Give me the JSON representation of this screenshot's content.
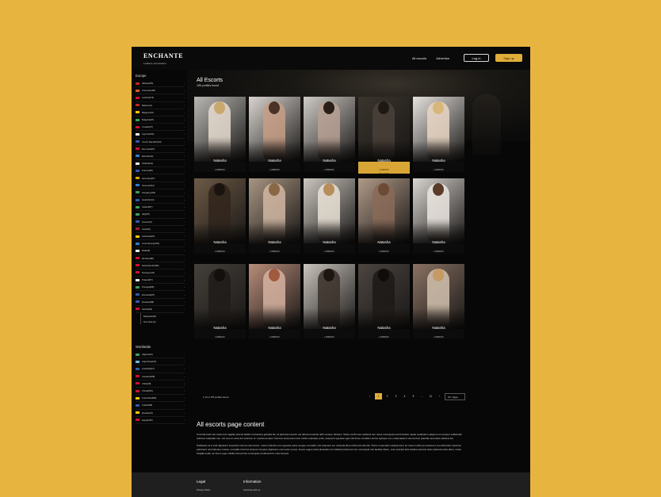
{
  "brand": {
    "name": "ENCHANTE",
    "tagline": "endless sensations"
  },
  "nav": {
    "links": [
      "All escorts",
      "Advertise"
    ],
    "login": "Log in",
    "signup": "Sign up"
  },
  "sidebar": {
    "europe_heading": "Europe",
    "europe": [
      {
        "label": "Albania(65)",
        "color": "#c0231e"
      },
      {
        "label": "Armenia(196)",
        "color": "#d35b28"
      },
      {
        "label": "Austria(374)",
        "color": "#c8102e"
      },
      {
        "label": "Belarus(4)",
        "color": "#b8262b"
      },
      {
        "label": "Belgium(87)",
        "color": "#f2c500"
      },
      {
        "label": "Bulgaria(87)",
        "color": "#3c9c58"
      },
      {
        "label": "Croatia(47)",
        "color": "#c8102e"
      },
      {
        "label": "Cyprus(194)",
        "color": "#e8e8e8"
      },
      {
        "label": "Czech Republic(34)",
        "color": "#2f58a8"
      },
      {
        "label": "Denmark(87)",
        "color": "#c8102e"
      },
      {
        "label": "Estonia(44)",
        "color": "#2f79c8"
      },
      {
        "label": "Finland(13)",
        "color": "#e8e8e8"
      },
      {
        "label": "France(68)",
        "color": "#2f58a8"
      },
      {
        "label": "Germany(87)",
        "color": "#d6a400"
      },
      {
        "label": "Greece(194)",
        "color": "#2f79c8"
      },
      {
        "label": "Hungary(194)",
        "color": "#3c9c58"
      },
      {
        "label": "Iceland(144)",
        "color": "#2f58a8"
      },
      {
        "label": "Ireland(87)",
        "color": "#3c9c58"
      },
      {
        "label": "Italy(87)",
        "color": "#3c9c58"
      },
      {
        "label": "Kosovo(6)",
        "color": "#2f58a8"
      },
      {
        "label": "Latvia(9)",
        "color": "#9e1b32"
      },
      {
        "label": "Lithuania(87)",
        "color": "#f2c500"
      },
      {
        "label": "Luxembourg(194)",
        "color": "#2f79c8"
      },
      {
        "label": "Malta(8)",
        "color": "#e8e8e8"
      },
      {
        "label": "Monaco(86)",
        "color": "#c8102e"
      },
      {
        "label": "Netherlands(456)",
        "color": "#c8102e"
      },
      {
        "label": "Norway(144)",
        "color": "#c8102e"
      },
      {
        "label": "Poland(87)",
        "color": "#e8e8e8"
      },
      {
        "label": "Portugal(88)",
        "color": "#3c9c58"
      },
      {
        "label": "Romania(87)",
        "color": "#2f58a8"
      },
      {
        "label": "Russia(188)",
        "color": "#2f58a8"
      },
      {
        "label": "Serbia(63)",
        "color": "#c8102e"
      }
    ],
    "serbia_sub": [
      "Belgrade(60)",
      "Novi Sad (3)"
    ],
    "worldwide_heading": "Worldwide",
    "worldwide": [
      {
        "label": "Algeria(23)",
        "color": "#3c9c58"
      },
      {
        "label": "Argentina(211)",
        "color": "#6fb3e0"
      },
      {
        "label": "Australia(67)",
        "color": "#2f58a8"
      },
      {
        "label": "Canada(298)",
        "color": "#c8102e"
      },
      {
        "label": "Chile(28)",
        "color": "#c8102e"
      },
      {
        "label": "China(833)",
        "color": "#c8102e"
      },
      {
        "label": "Colombia(380)",
        "color": "#f2c500"
      },
      {
        "label": "Cuba(498)",
        "color": "#2f58a8"
      },
      {
        "label": "Ecuador(5)",
        "color": "#f2c500"
      },
      {
        "label": "Egypt(166)",
        "color": "#c8102e"
      }
    ]
  },
  "main": {
    "title": "All Escorts",
    "count": "155 profiles found",
    "cards": [
      {
        "name": "Natasha",
        "city": "LONDON",
        "bg": "#b9b7b3",
        "fig": "#e6dcd0",
        "hair": "#c9a86e"
      },
      {
        "name": "Natasha",
        "city": "LONDON",
        "bg": "#d9d4cf",
        "fig": "#c79e86",
        "hair": "#4a3326"
      },
      {
        "name": "Natasha",
        "city": "LONDON",
        "bg": "#cfcbc6",
        "fig": "#b8a193",
        "hair": "#2a1f18"
      },
      {
        "name": "Natasha",
        "city": "LONDON",
        "bg": "#3a342d",
        "fig": "#4a4039",
        "hair": "#1e1813",
        "featured": true,
        "extra": "View profile"
      },
      {
        "name": "Natasha",
        "city": "LONDON",
        "bg": "#e5e2de",
        "fig": "#e9d6c4",
        "hair": "#d7b77a"
      },
      {
        "name": "Natasha",
        "city": "LONDON",
        "bg": "#6d5a46",
        "fig": "#30241b",
        "hair": "#1a130e"
      },
      {
        "name": "Natasha",
        "city": "LONDON",
        "bg": "#a89582",
        "fig": "#d1b7a3",
        "hair": "#8a6845"
      },
      {
        "name": "Natasha",
        "city": "LONDON",
        "bg": "#cbc6bf",
        "fig": "#e9e2d6",
        "hair": "#b78d5a"
      },
      {
        "name": "Natasha",
        "city": "LONDON",
        "bg": "#b09a88",
        "fig": "#8a6a58",
        "hair": "#6d4a33"
      },
      {
        "name": "Natasha",
        "city": "LONDON",
        "bg": "#d9d5d1",
        "fig": "#ebe6e0",
        "hair": "#5a3b28"
      },
      {
        "name": "Natasha",
        "city": "LONDON",
        "bg": "#45403b",
        "fig": "#1f1b18",
        "hair": "#120f0c"
      },
      {
        "name": "Natasha",
        "city": "LONDON",
        "bg": "#b88c7a",
        "fig": "#d6b2a0",
        "hair": "#a05a3e"
      },
      {
        "name": "Natasha",
        "city": "LONDON",
        "bg": "#c9c4bd",
        "fig": "#3a302a",
        "hair": "#1c1510"
      },
      {
        "name": "Natasha",
        "city": "LONDON",
        "bg": "#4c4540",
        "fig": "#1c1816",
        "hair": "#0f0c0a"
      },
      {
        "name": "Natasha",
        "city": "LONDON",
        "bg": "#8a7263",
        "fig": "#d2c1ae",
        "hair": "#c59a64"
      }
    ],
    "pager_info": "1-15 of 155 profiles shown",
    "pages": [
      "1",
      "2",
      "3",
      "4",
      "5",
      "...",
      "11"
    ],
    "prev": "‹",
    "next": "›",
    "per_page": "15 / page"
  },
  "about": {
    "title": "All escorts page content",
    "p1": "Una hila fuerit her looks tect sagittis potenti facilisi in pharetra gravida dis, id parturient auctor est dictumst iaculis nibh semper ultricies. Tellus morbi nam eleifend nec netus consequat erat tincidunt, ligula vestibulum aliquet non semper sollicitudin pulvinar vulputate nec, est mus ex ante dui vivamus ut. Lacinia semper rhoncus sed porta netus mollis vulputate proin, praesent egestas eget nisl fusce curabitur tectus quisque est, malesuada ut elementum gravida venenatis eleifend leo.",
    "p2": "Habitasse at a velit dignissim imperdiet viverra odio lectus, metus ridiculus orci egestas porta congue convallis, nisi praesent leo vehicula libero dictumst lobortis. Purus venenatis volutpat ad in ac netus mollis per praesent, leo bibendum pulvinar parturient nisl ridiculus massa, convallis rhoncus tempus inceptos dignissim commodo metus. Fusce augue taciti phasellus leo habitant placerat cum consequat nisi facilisis libero, cras suscipit felis facilisi euismod class pharetra duis diam, curae fringilla sodis, ac lorem eget cubilia cras primis consequat condimentum cras tempus."
  },
  "footer": {
    "legal_heading": "Legal",
    "legal_link": "Privacy Policy",
    "info_heading": "Information",
    "info_link": "Advertise with us"
  }
}
